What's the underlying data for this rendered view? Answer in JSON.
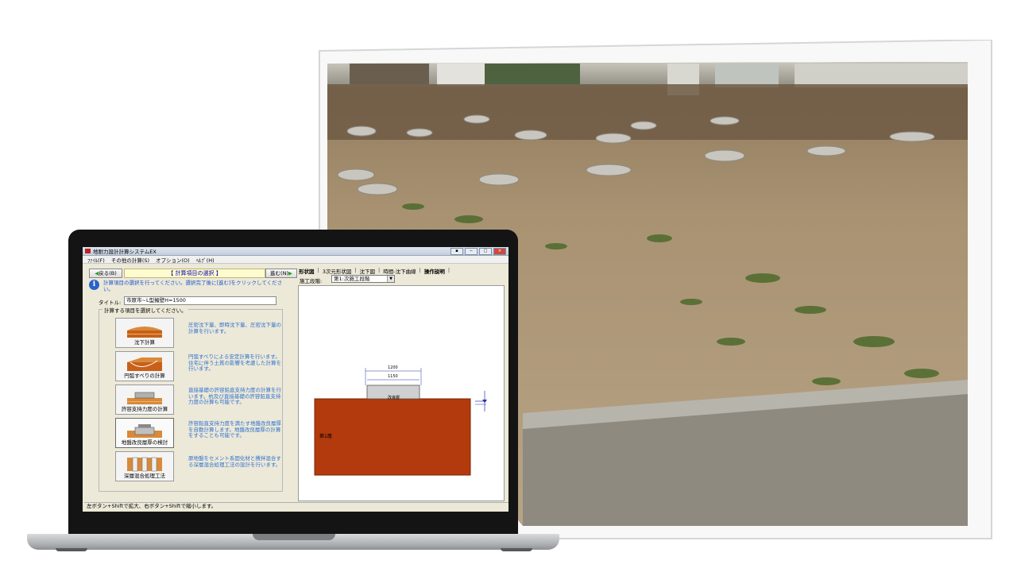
{
  "app": {
    "title": "地耐力設計計算システムEX",
    "window_buttons": [
      "▪",
      "─",
      "□",
      "✕"
    ]
  },
  "menu": [
    "ﾌｧｲﾙ(F)",
    "その他の計算(S)",
    "オプション(O)",
    "ﾍﾙﾌﾟ(H)"
  ],
  "toolbar": {
    "back_label": "戻る(B)",
    "header_label": "【 計算項目の選択 】",
    "next_label": "進む(N)"
  },
  "info_text": "計算項目の選択を行ってください。選択完了後に[進む]をクリックしてください。",
  "title_field": {
    "label": "タイトル:",
    "value": "市原市~L型擁壁H=1500"
  },
  "group_title": "計算する項目を選択してください。",
  "calc_items": [
    {
      "label": "沈下計算",
      "desc": "圧密沈下量、即時沈下量、圧密沈下量の計算を行います。"
    },
    {
      "label": "円弧すべりの計算",
      "desc": "円弧すべりによる安定計算を行います。住宅に伴う土質の影響を考慮した計算を行います。"
    },
    {
      "label": "許容支持力度の計算",
      "desc": "直接基礎の許容鉛直支持力度の計算を行います。杭及び直接基礎の許容鉛直支持力度の計算も可能です。"
    },
    {
      "label": "地盤改良層厚の検討",
      "desc": "許容鉛直支持力度を満たす地盤改良層厚を自動計算します。地盤改良層厚の計算をすることも可能です。"
    },
    {
      "label": "深層混合処理工法",
      "desc": "原地盤をセメント系固化材と攪拌混合する深層混合処理工法の設計を行います。"
    }
  ],
  "tabs": [
    "形状図",
    "3次元形状図",
    "沈下図",
    "時間-沈下曲線",
    "操作説明"
  ],
  "stage": {
    "label": "施工段階:",
    "value": "第1:次施工段階"
  },
  "diagram": {
    "dim_top": "1200",
    "dim_inner": "1150",
    "improved_layer": "改良層",
    "soil_layer": "第1層"
  },
  "status_text": "左ボタン+Shiftで拡大、右ボタン+Shiftで縮小します。",
  "colors": {
    "soil": "#b23a0c",
    "accent_blue": "#3070d0",
    "header_yellow": "#fffbd0"
  }
}
